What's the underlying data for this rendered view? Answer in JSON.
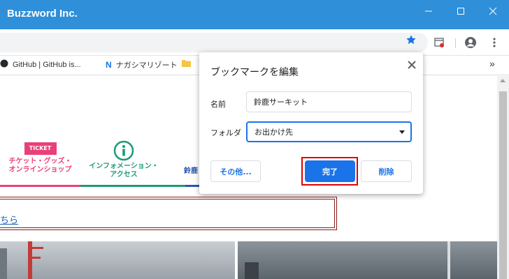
{
  "window": {
    "title": "Buzzword Inc."
  },
  "bookmarks_bar": {
    "items": [
      {
        "label": "GitHub | GitHub is..."
      },
      {
        "label": "ナガシマリゾート"
      }
    ],
    "overflow": "»"
  },
  "page": {
    "nav": [
      {
        "label_line1": "チケット・グッズ・",
        "label_line2": "オンラインショップ",
        "color": "#e8417a",
        "badge": "TICKET"
      },
      {
        "label_line1": "インフォメーション・",
        "label_line2": "アクセス",
        "color": "#1e9b78"
      },
      {
        "label_line1": "",
        "label_line2": "鈴鹿",
        "color": "#2a55b0"
      }
    ],
    "notice_link": "ちら"
  },
  "dialog": {
    "title": "ブックマークを編集",
    "name_label": "名前",
    "name_value": "鈴鹿サーキット",
    "folder_label": "フォルダ",
    "folder_value": "お出かけ先",
    "more_button": "その他...",
    "done_button": "完了",
    "delete_button": "削除",
    "close_icon": "close-icon"
  },
  "colors": {
    "titlebar": "#2f8fd8",
    "accent": "#1a73e8",
    "highlight": "#e00000"
  }
}
